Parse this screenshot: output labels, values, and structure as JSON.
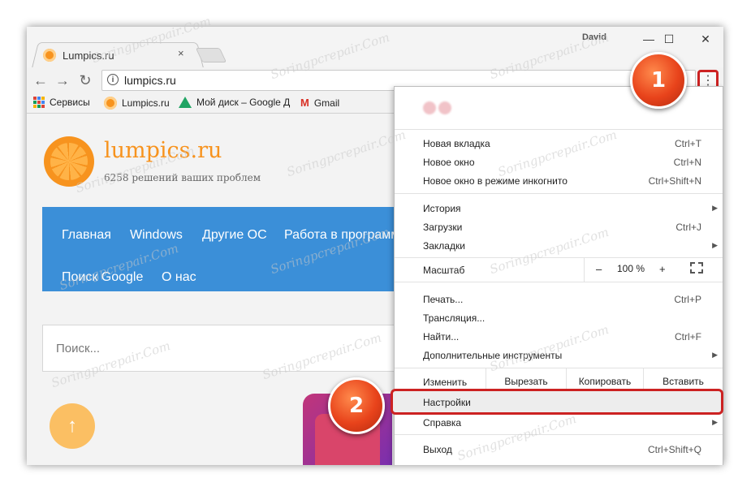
{
  "window": {
    "tab_title": "Lumpics.ru",
    "tab_close": "×",
    "user": "David",
    "minimize": "—",
    "maximize": "☐",
    "close": "✕"
  },
  "toolbar": {
    "back": "←",
    "forward": "→",
    "reload": "↻",
    "info": "i",
    "url": "lumpics.ru",
    "menu_icon": "⋮"
  },
  "bookmarks": [
    {
      "label": "Сервисы",
      "icon": "apps-icon"
    },
    {
      "label": "Lumpics.ru",
      "icon": "orange-icon"
    },
    {
      "label": "Мой диск – Google Д",
      "icon": "drive-icon"
    },
    {
      "label": "Gmail",
      "icon": "gmail-icon"
    }
  ],
  "site": {
    "title": "lumpics.ru",
    "tagline": "6258 решений ваших проблем",
    "nav": [
      "Главная",
      "Windows",
      "Другие ОС",
      "Работа в программ",
      "Поиск Google",
      "О нас"
    ],
    "search_placeholder": "Поиск...",
    "up_arrow": "↑"
  },
  "menu": {
    "group1": [
      {
        "label": "Новая вкладка",
        "shortcut": "Ctrl+T"
      },
      {
        "label": "Новое окно",
        "shortcut": "Ctrl+N"
      },
      {
        "label": "Новое окно в режиме инкогнито",
        "shortcut": "Ctrl+Shift+N"
      }
    ],
    "group2": [
      {
        "label": "История",
        "arrow": "▶"
      },
      {
        "label": "Загрузки",
        "shortcut": "Ctrl+J"
      },
      {
        "label": "Закладки",
        "arrow": "▶"
      }
    ],
    "zoom": {
      "label": "Масштаб",
      "minus": "–",
      "value": "100 %",
      "plus": "+"
    },
    "group3": [
      {
        "label": "Печать...",
        "shortcut": "Ctrl+P"
      },
      {
        "label": "Трансляция..."
      },
      {
        "label": "Найти...",
        "shortcut": "Ctrl+F"
      },
      {
        "label": "Дополнительные инструменты",
        "arrow": "▶"
      }
    ],
    "edit": {
      "label": "Изменить",
      "cut": "Вырезать",
      "copy": "Копировать",
      "paste": "Вставить"
    },
    "settings": "Настройки",
    "help": {
      "label": "Справка",
      "arrow": "▶"
    },
    "exit": {
      "label": "Выход",
      "shortcut": "Ctrl+Shift+Q"
    }
  },
  "callouts": {
    "one": "1",
    "two": "2"
  },
  "watermark": "Soringpcrepair.Com"
}
